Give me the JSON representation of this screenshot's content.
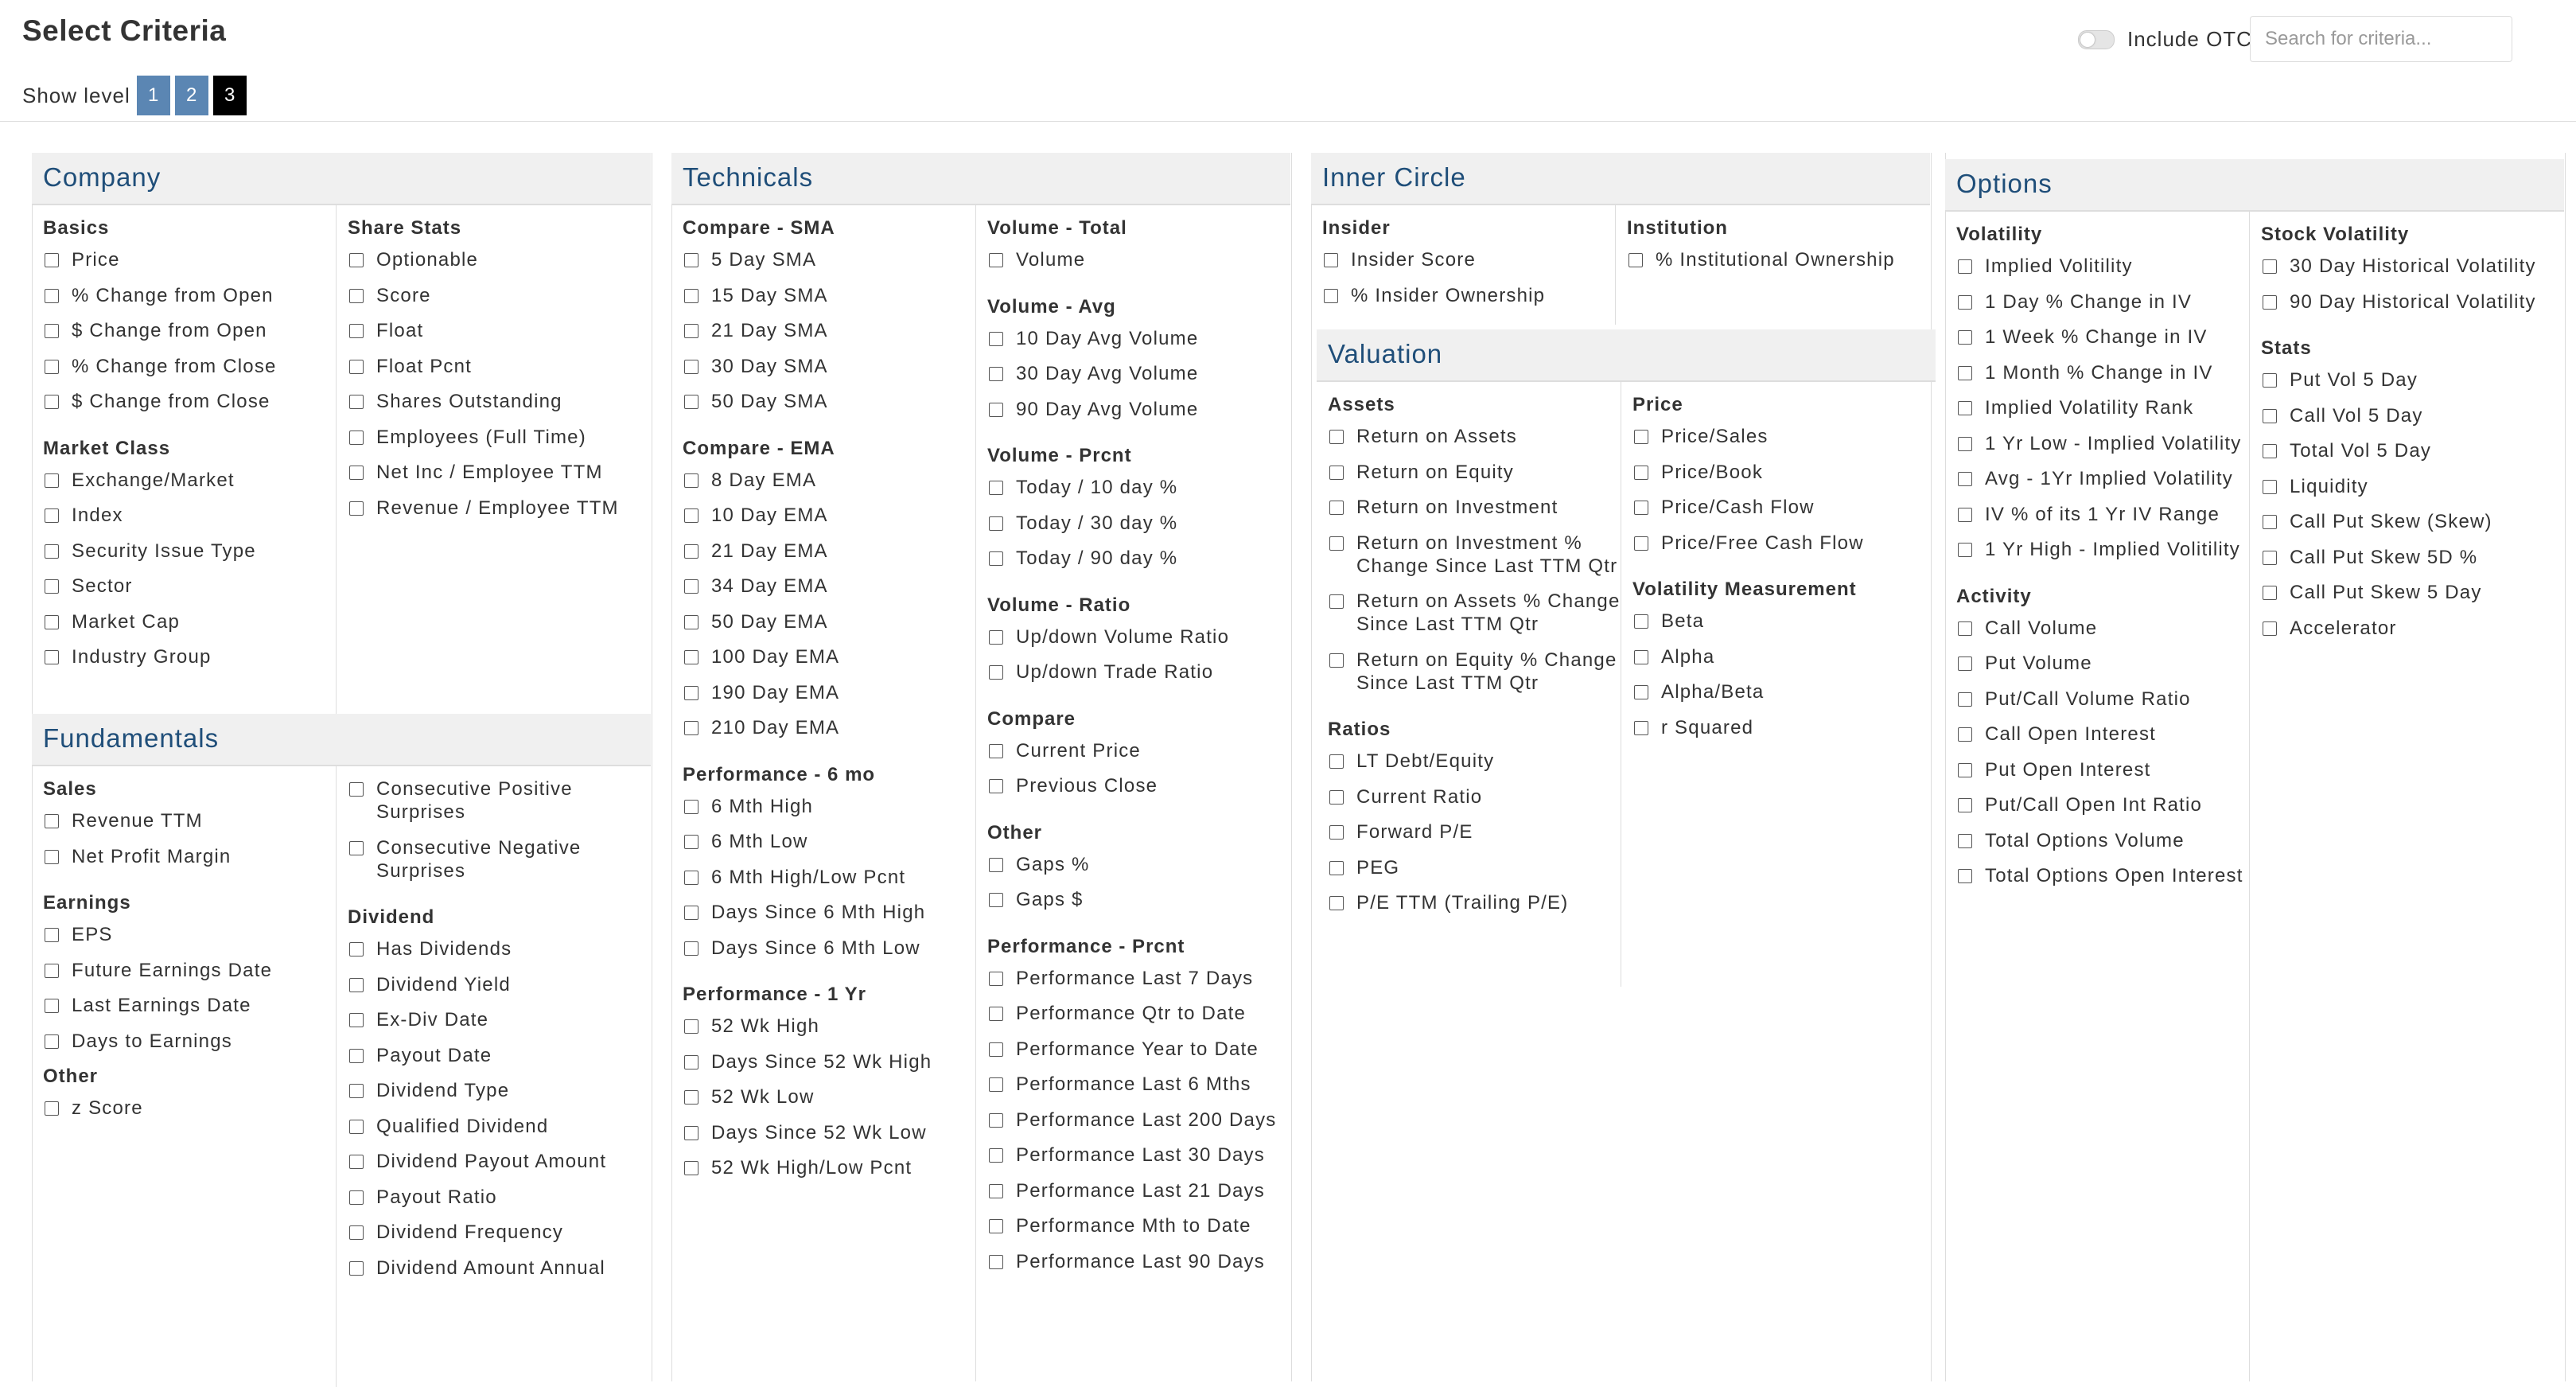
{
  "header": {
    "title": "Select Criteria",
    "show_level_label": "Show level",
    "levels": [
      "1",
      "2",
      "3"
    ],
    "active_level": "3",
    "include_otc_label": "Include OTC",
    "include_otc_enabled": false,
    "search_placeholder": "Search for criteria..."
  },
  "colors": {
    "section_title": "#1f4e79",
    "level_button": "#5b86b3",
    "level_button_active": "#000000"
  },
  "company": {
    "title": "Company",
    "basics": {
      "title": "Basics",
      "items": [
        "Price",
        "% Change from Open",
        "$ Change from Open",
        "% Change from Close",
        "$ Change from Close"
      ]
    },
    "market_class": {
      "title": "Market Class",
      "items": [
        "Exchange/Market",
        "Index",
        "Security Issue Type",
        "Sector",
        "Market Cap",
        "Industry Group"
      ]
    },
    "share_stats": {
      "title": "Share Stats",
      "items": [
        "Optionable",
        "Score",
        "Float",
        "Float Pcnt",
        "Shares Outstanding",
        "Employees (Full Time)",
        "Net Inc / Employee TTM",
        "Revenue / Employee TTM"
      ]
    }
  },
  "fundamentals": {
    "title": "Fundamentals",
    "sales": {
      "title": "Sales",
      "items": [
        "Revenue TTM",
        "Net Profit Margin"
      ]
    },
    "earnings": {
      "title": "Earnings",
      "items": [
        "EPS",
        "Future Earnings Date",
        "Last Earnings Date",
        "Days to Earnings"
      ]
    },
    "other": {
      "title": "Other",
      "items": [
        "z Score"
      ]
    },
    "surprises": {
      "items": [
        "Consecutive Positive Surprises",
        "Consecutive Negative Surprises"
      ]
    },
    "dividend": {
      "title": "Dividend",
      "items": [
        "Has Dividends",
        "Dividend Yield",
        "Ex-Div Date",
        "Payout Date",
        "Dividend Type",
        "Qualified Dividend",
        "Dividend Payout Amount",
        "Payout Ratio",
        "Dividend Frequency",
        "Dividend Amount Annual"
      ]
    }
  },
  "technicals": {
    "title": "Technicals",
    "compare_sma": {
      "title": "Compare - SMA",
      "items": [
        "5 Day SMA",
        "15 Day SMA",
        "21 Day SMA",
        "30 Day SMA",
        "50 Day SMA"
      ]
    },
    "compare_ema": {
      "title": "Compare - EMA",
      "items": [
        "8 Day EMA",
        "10 Day EMA",
        "21 Day EMA",
        "34 Day EMA",
        "50 Day EMA",
        "100 Day EMA",
        "190 Day EMA",
        "210 Day EMA"
      ]
    },
    "perf_6mo": {
      "title": "Performance - 6 mo",
      "items": [
        "6 Mth High",
        "6 Mth Low",
        "6 Mth High/Low Pcnt",
        "Days Since 6 Mth High",
        "Days Since 6 Mth Low"
      ]
    },
    "perf_1yr": {
      "title": "Performance - 1 Yr",
      "items": [
        "52 Wk High",
        "Days Since 52 Wk High",
        "52 Wk Low",
        "Days Since 52 Wk Low",
        "52 Wk High/Low Pcnt"
      ]
    },
    "volume_total": {
      "title": "Volume - Total",
      "items": [
        "Volume"
      ]
    },
    "volume_avg": {
      "title": "Volume - Avg",
      "items": [
        "10 Day Avg Volume",
        "30 Day Avg Volume",
        "90 Day Avg Volume"
      ]
    },
    "volume_prcnt": {
      "title": "Volume - Prcnt",
      "items": [
        "Today / 10 day %",
        "Today / 30 day %",
        "Today / 90 day %"
      ]
    },
    "volume_ratio": {
      "title": "Volume - Ratio",
      "items": [
        "Up/down Volume Ratio",
        "Up/down Trade Ratio"
      ]
    },
    "compare": {
      "title": "Compare",
      "items": [
        "Current Price",
        "Previous Close"
      ]
    },
    "other": {
      "title": "Other",
      "items": [
        "Gaps %",
        "Gaps $"
      ]
    },
    "perf_prcnt": {
      "title": "Performance - Prcnt",
      "items": [
        "Performance Last 7 Days",
        "Performance Qtr to Date",
        "Performance Year to Date",
        "Performance Last 6 Mths",
        "Performance Last 200 Days",
        "Performance Last 30 Days",
        "Performance Last 21 Days",
        "Performance Mth to Date",
        "Performance Last 90 Days"
      ]
    }
  },
  "inner_circle": {
    "title": "Inner Circle",
    "insider": {
      "title": "Insider",
      "items": [
        "Insider Score",
        "% Insider Ownership"
      ]
    },
    "institution": {
      "title": "Institution",
      "items": [
        "% Institutional Ownership"
      ]
    }
  },
  "valuation": {
    "title": "Valuation",
    "assets": {
      "title": "Assets",
      "items": [
        "Return on Assets",
        "Return on Equity",
        "Return on Investment",
        "Return on Investment % Change Since Last TTM Qtr",
        "Return on Assets % Change Since Last TTM Qtr",
        "Return on Equity % Change Since Last TTM Qtr"
      ]
    },
    "ratios": {
      "title": "Ratios",
      "items": [
        "LT Debt/Equity",
        "Current Ratio",
        "Forward P/E",
        "PEG",
        "P/E TTM (Trailing P/E)"
      ]
    },
    "price": {
      "title": "Price",
      "items": [
        "Price/Sales",
        "Price/Book",
        "Price/Cash Flow",
        "Price/Free Cash Flow"
      ]
    },
    "volatility_measurement": {
      "title": "Volatility Measurement",
      "items": [
        "Beta",
        "Alpha",
        "Alpha/Beta",
        "r Squared"
      ]
    }
  },
  "options": {
    "title": "Options",
    "volatility": {
      "title": "Volatility",
      "items": [
        "Implied Volitility",
        "1 Day % Change in IV",
        "1 Week % Change in IV",
        "1 Month % Change in IV",
        "Implied Volatility Rank",
        "1 Yr Low - Implied Volatility",
        "Avg - 1Yr Implied Volatility",
        "IV % of its 1 Yr IV Range",
        "1 Yr High - Implied Volitility"
      ]
    },
    "activity": {
      "title": "Activity",
      "items": [
        "Call Volume",
        "Put Volume",
        "Put/Call Volume Ratio",
        "Call Open Interest",
        "Put Open Interest",
        "Put/Call Open Int Ratio",
        "Total Options Volume",
        "Total Options Open Interest"
      ]
    },
    "stock_volatility": {
      "title": "Stock Volatility",
      "items": [
        "30 Day Historical Volatility",
        "90 Day Historical Volatility"
      ]
    },
    "stats": {
      "title": "Stats",
      "items": [
        "Put Vol 5 Day",
        "Call Vol 5 Day",
        "Total Vol 5 Day",
        "Liquidity",
        "Call Put Skew (Skew)",
        "Call Put Skew 5D %",
        "Call Put Skew 5 Day",
        "Accelerator"
      ]
    }
  }
}
